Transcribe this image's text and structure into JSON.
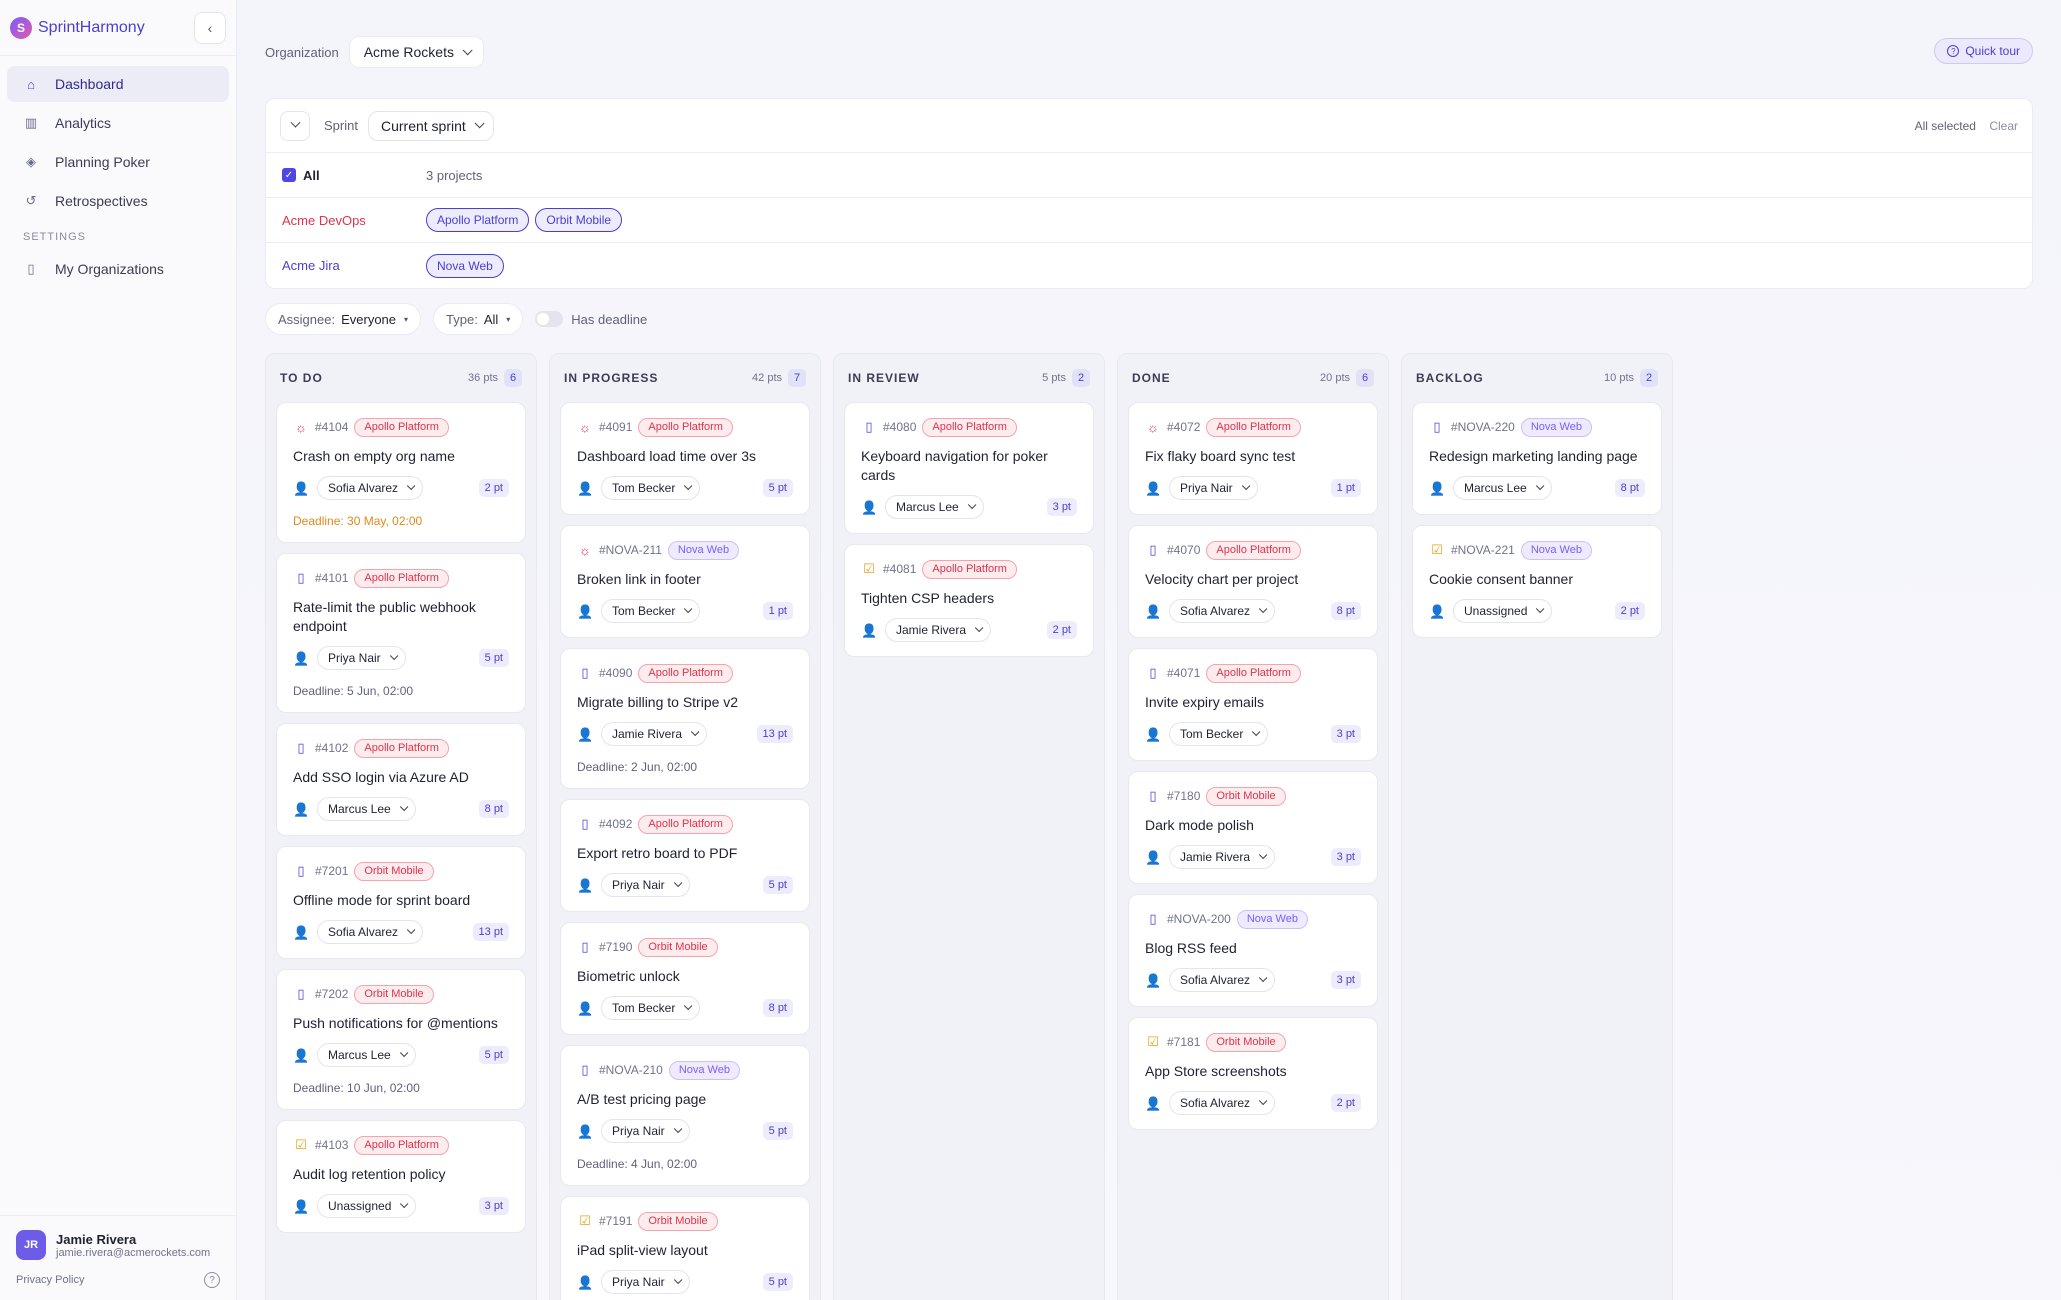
{
  "app": {
    "name": "SprintHarmony",
    "logo_letter": "S"
  },
  "sidebar": {
    "items": [
      {
        "label": "Dashboard",
        "icon": "home-icon",
        "active": true
      },
      {
        "label": "Analytics",
        "icon": "bar-chart-icon"
      },
      {
        "label": "Planning Poker",
        "icon": "diamond-icon"
      },
      {
        "label": "Retrospectives",
        "icon": "refresh-icon"
      }
    ],
    "settings_label": "SETTINGS",
    "settings_items": [
      {
        "label": "My Organizations",
        "icon": "book-icon"
      }
    ]
  },
  "user": {
    "initials": "JR",
    "name": "Jamie Rivera",
    "email": "jamie.rivera@acmerockets.com"
  },
  "footer": {
    "privacy": "Privacy Policy"
  },
  "topbar": {
    "org_label": "Organization",
    "org_value": "Acme Rockets",
    "quick_tour": "Quick tour"
  },
  "filters": {
    "sprint_label": "Sprint",
    "sprint_value": "Current sprint",
    "all_selected": "All selected",
    "clear": "Clear",
    "all_label": "All",
    "projects_count": "3 projects",
    "orgs": [
      {
        "name": "Acme DevOps",
        "projects": [
          "Apollo Platform",
          "Orbit Mobile"
        ]
      },
      {
        "name": "Acme Jira",
        "projects": [
          "Nova Web"
        ]
      }
    ],
    "assignee_label": "Assignee:",
    "assignee_value": "Everyone",
    "type_label": "Type:",
    "type_value": "All",
    "deadline_label": "Has deadline"
  },
  "board": {
    "columns": [
      {
        "title": "TO DO",
        "points": "36 pts",
        "count": "6",
        "cards": [
          {
            "type": "bug",
            "id": "#4104",
            "project": "Apollo Platform",
            "pclass": "apollo",
            "title": "Crash on empty org name",
            "assignee": "Sofia Alvarez",
            "pts": "2 pt",
            "deadline": "Deadline: 30 May, 02:00",
            "warn": true
          },
          {
            "type": "story",
            "id": "#4101",
            "project": "Apollo Platform",
            "pclass": "apollo",
            "title": "Rate-limit the public webhook endpoint",
            "assignee": "Priya Nair",
            "pts": "5 pt",
            "deadline": "Deadline: 5 Jun, 02:00"
          },
          {
            "type": "story",
            "id": "#4102",
            "project": "Apollo Platform",
            "pclass": "apollo",
            "title": "Add SSO login via Azure AD",
            "assignee": "Marcus Lee",
            "pts": "8 pt"
          },
          {
            "type": "story",
            "id": "#7201",
            "project": "Orbit Mobile",
            "pclass": "orbit",
            "title": "Offline mode for sprint board",
            "assignee": "Sofia Alvarez",
            "pts": "13 pt"
          },
          {
            "type": "story",
            "id": "#7202",
            "project": "Orbit Mobile",
            "pclass": "orbit",
            "title": "Push notifications for @mentions",
            "assignee": "Marcus Lee",
            "pts": "5 pt",
            "deadline": "Deadline: 10 Jun, 02:00"
          },
          {
            "type": "task",
            "id": "#4103",
            "project": "Apollo Platform",
            "pclass": "apollo",
            "title": "Audit log retention policy",
            "assignee": "Unassigned",
            "pts": "3 pt"
          }
        ]
      },
      {
        "title": "IN PROGRESS",
        "points": "42 pts",
        "count": "7",
        "cards": [
          {
            "type": "bug",
            "id": "#4091",
            "project": "Apollo Platform",
            "pclass": "apollo",
            "title": "Dashboard load time over 3s",
            "assignee": "Tom Becker",
            "pts": "5 pt"
          },
          {
            "type": "bug",
            "id": "#NOVA-211",
            "project": "Nova Web",
            "pclass": "nova",
            "title": "Broken link in footer",
            "assignee": "Tom Becker",
            "pts": "1 pt"
          },
          {
            "type": "story",
            "id": "#4090",
            "project": "Apollo Platform",
            "pclass": "apollo",
            "title": "Migrate billing to Stripe v2",
            "assignee": "Jamie Rivera",
            "pts": "13 pt",
            "deadline": "Deadline: 2 Jun, 02:00"
          },
          {
            "type": "story",
            "id": "#4092",
            "project": "Apollo Platform",
            "pclass": "apollo",
            "title": "Export retro board to PDF",
            "assignee": "Priya Nair",
            "pts": "5 pt"
          },
          {
            "type": "story",
            "id": "#7190",
            "project": "Orbit Mobile",
            "pclass": "orbit",
            "title": "Biometric unlock",
            "assignee": "Tom Becker",
            "pts": "8 pt"
          },
          {
            "type": "story",
            "id": "#NOVA-210",
            "project": "Nova Web",
            "pclass": "nova",
            "title": "A/B test pricing page",
            "assignee": "Priya Nair",
            "pts": "5 pt",
            "deadline": "Deadline: 4 Jun, 02:00"
          },
          {
            "type": "task",
            "id": "#7191",
            "project": "Orbit Mobile",
            "pclass": "orbit",
            "title": "iPad split-view layout",
            "assignee": "Priya Nair",
            "pts": "5 pt"
          }
        ]
      },
      {
        "title": "IN REVIEW",
        "points": "5 pts",
        "count": "2",
        "cards": [
          {
            "type": "story",
            "id": "#4080",
            "project": "Apollo Platform",
            "pclass": "apollo",
            "title": "Keyboard navigation for poker cards",
            "assignee": "Marcus Lee",
            "pts": "3 pt"
          },
          {
            "type": "task",
            "id": "#4081",
            "project": "Apollo Platform",
            "pclass": "apollo",
            "title": "Tighten CSP headers",
            "assignee": "Jamie Rivera",
            "pts": "2 pt"
          }
        ]
      },
      {
        "title": "DONE",
        "points": "20 pts",
        "count": "6",
        "cards": [
          {
            "type": "bug",
            "id": "#4072",
            "project": "Apollo Platform",
            "pclass": "apollo",
            "title": "Fix flaky board sync test",
            "assignee": "Priya Nair",
            "pts": "1 pt"
          },
          {
            "type": "story",
            "id": "#4070",
            "project": "Apollo Platform",
            "pclass": "apollo",
            "title": "Velocity chart per project",
            "assignee": "Sofia Alvarez",
            "pts": "8 pt"
          },
          {
            "type": "story",
            "id": "#4071",
            "project": "Apollo Platform",
            "pclass": "apollo",
            "title": "Invite expiry emails",
            "assignee": "Tom Becker",
            "pts": "3 pt"
          },
          {
            "type": "story",
            "id": "#7180",
            "project": "Orbit Mobile",
            "pclass": "orbit",
            "title": "Dark mode polish",
            "assignee": "Jamie Rivera",
            "pts": "3 pt"
          },
          {
            "type": "story",
            "id": "#NOVA-200",
            "project": "Nova Web",
            "pclass": "nova",
            "title": "Blog RSS feed",
            "assignee": "Sofia Alvarez",
            "pts": "3 pt"
          },
          {
            "type": "task",
            "id": "#7181",
            "project": "Orbit Mobile",
            "pclass": "orbit",
            "title": "App Store screenshots",
            "assignee": "Sofia Alvarez",
            "pts": "2 pt"
          }
        ]
      },
      {
        "title": "BACKLOG",
        "points": "10 pts",
        "count": "2",
        "cards": [
          {
            "type": "story",
            "id": "#NOVA-220",
            "project": "Nova Web",
            "pclass": "nova",
            "title": "Redesign marketing landing page",
            "assignee": "Marcus Lee",
            "pts": "8 pt"
          },
          {
            "type": "task",
            "id": "#NOVA-221",
            "project": "Nova Web",
            "pclass": "nova",
            "title": "Cookie consent banner",
            "assignee": "Unassigned",
            "pts": "2 pt"
          }
        ]
      }
    ]
  }
}
